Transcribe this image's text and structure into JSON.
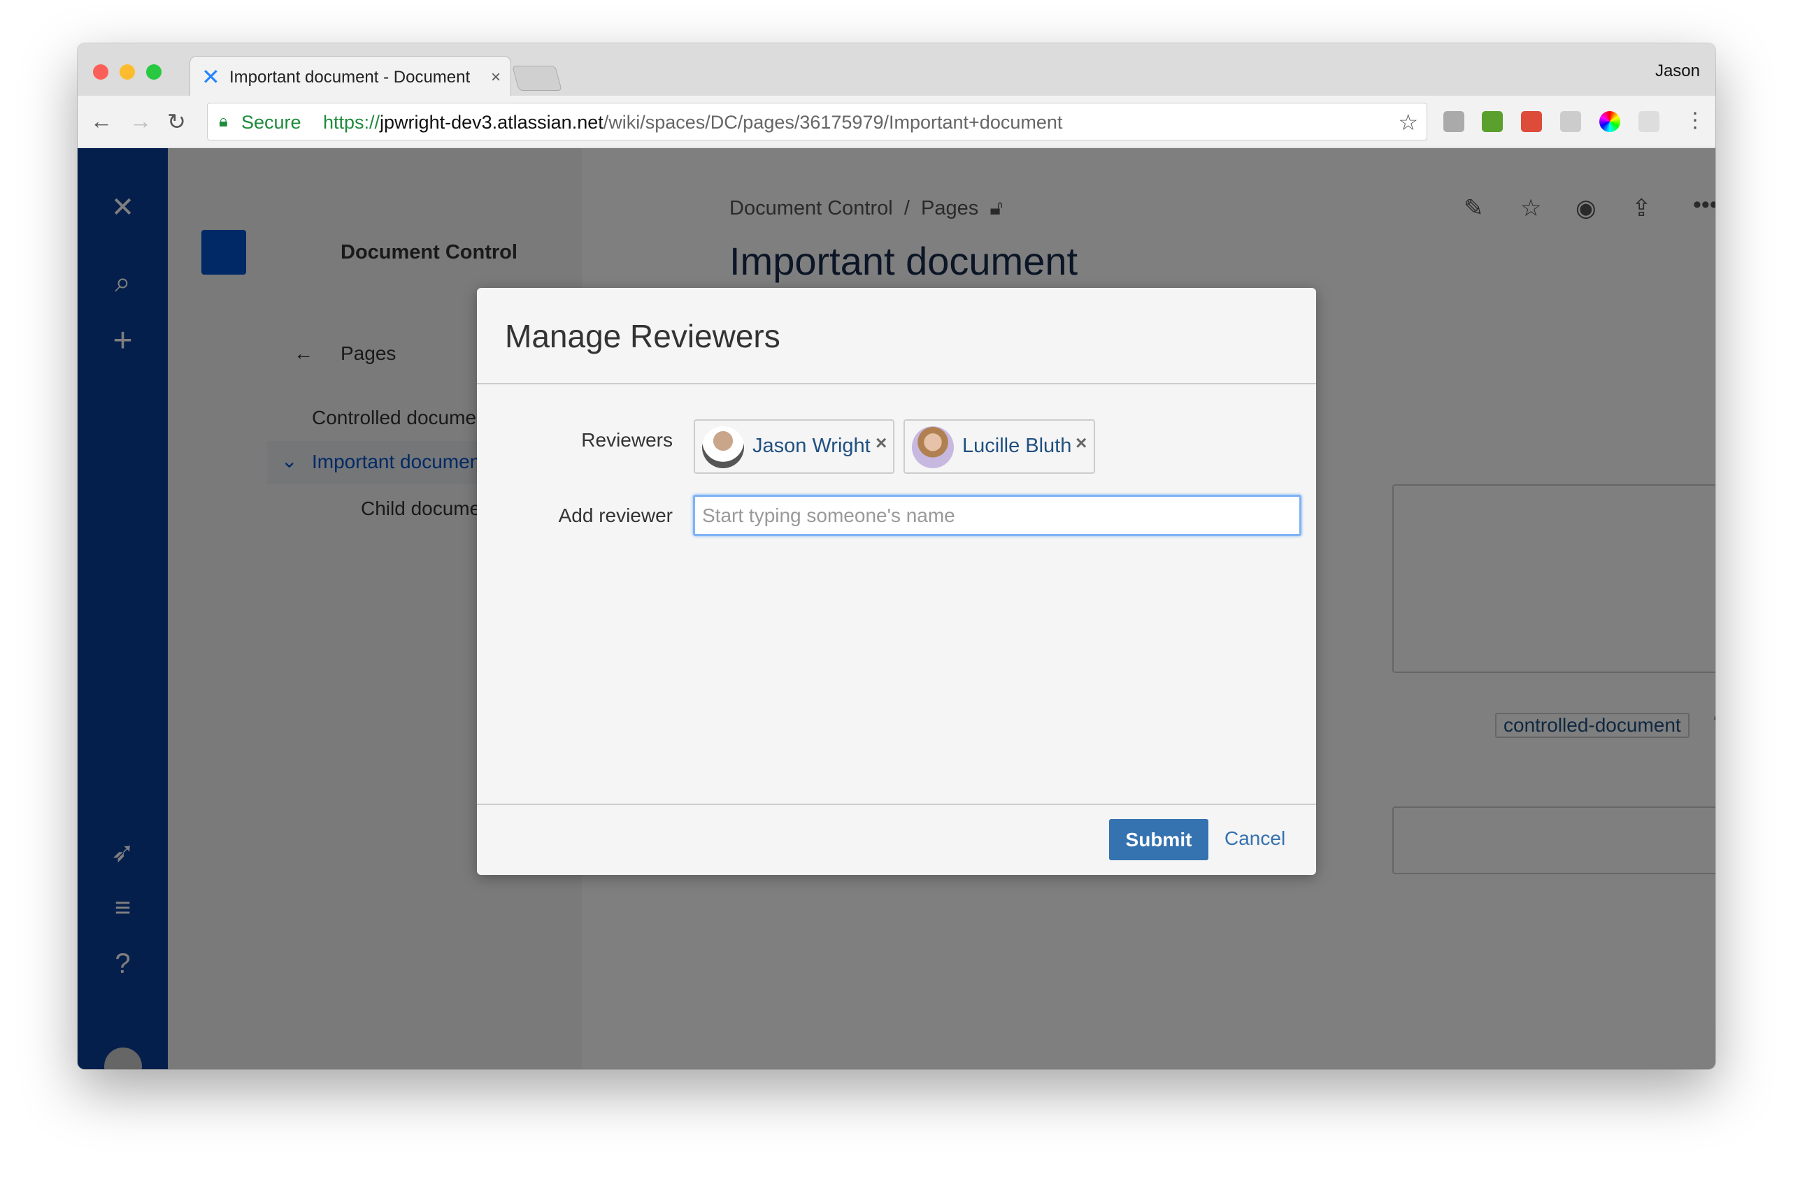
{
  "browser": {
    "tab_title": "Important document - Document Control",
    "user": "Jason",
    "secure_label": "Secure",
    "url_scheme": "https://",
    "url_host": "jpwright-dev3.atlassian.net",
    "url_path": "/wiki/spaces/DC/pages/36175979/Important+document"
  },
  "space": {
    "name": "Document Control"
  },
  "sidebar": {
    "back_label": "Pages",
    "items": [
      {
        "label": "Controlled document"
      },
      {
        "label": "Important document",
        "selected": true
      },
      {
        "label": "Child document"
      }
    ]
  },
  "content": {
    "breadcrumb": [
      "Document Control",
      "Pages"
    ],
    "title": "Important document",
    "label": "controlled-document"
  },
  "modal": {
    "title": "Manage Reviewers",
    "reviewers_label": "Reviewers",
    "reviewers": [
      {
        "name": "Jason Wright"
      },
      {
        "name": "Lucille Bluth"
      }
    ],
    "add_label": "Add reviewer",
    "add_placeholder": "Start typing someone's name",
    "add_value": "",
    "submit": "Submit",
    "cancel": "Cancel"
  },
  "colors": {
    "accent": "#3572b0",
    "nav": "#0a3f99",
    "link": "#205081"
  }
}
